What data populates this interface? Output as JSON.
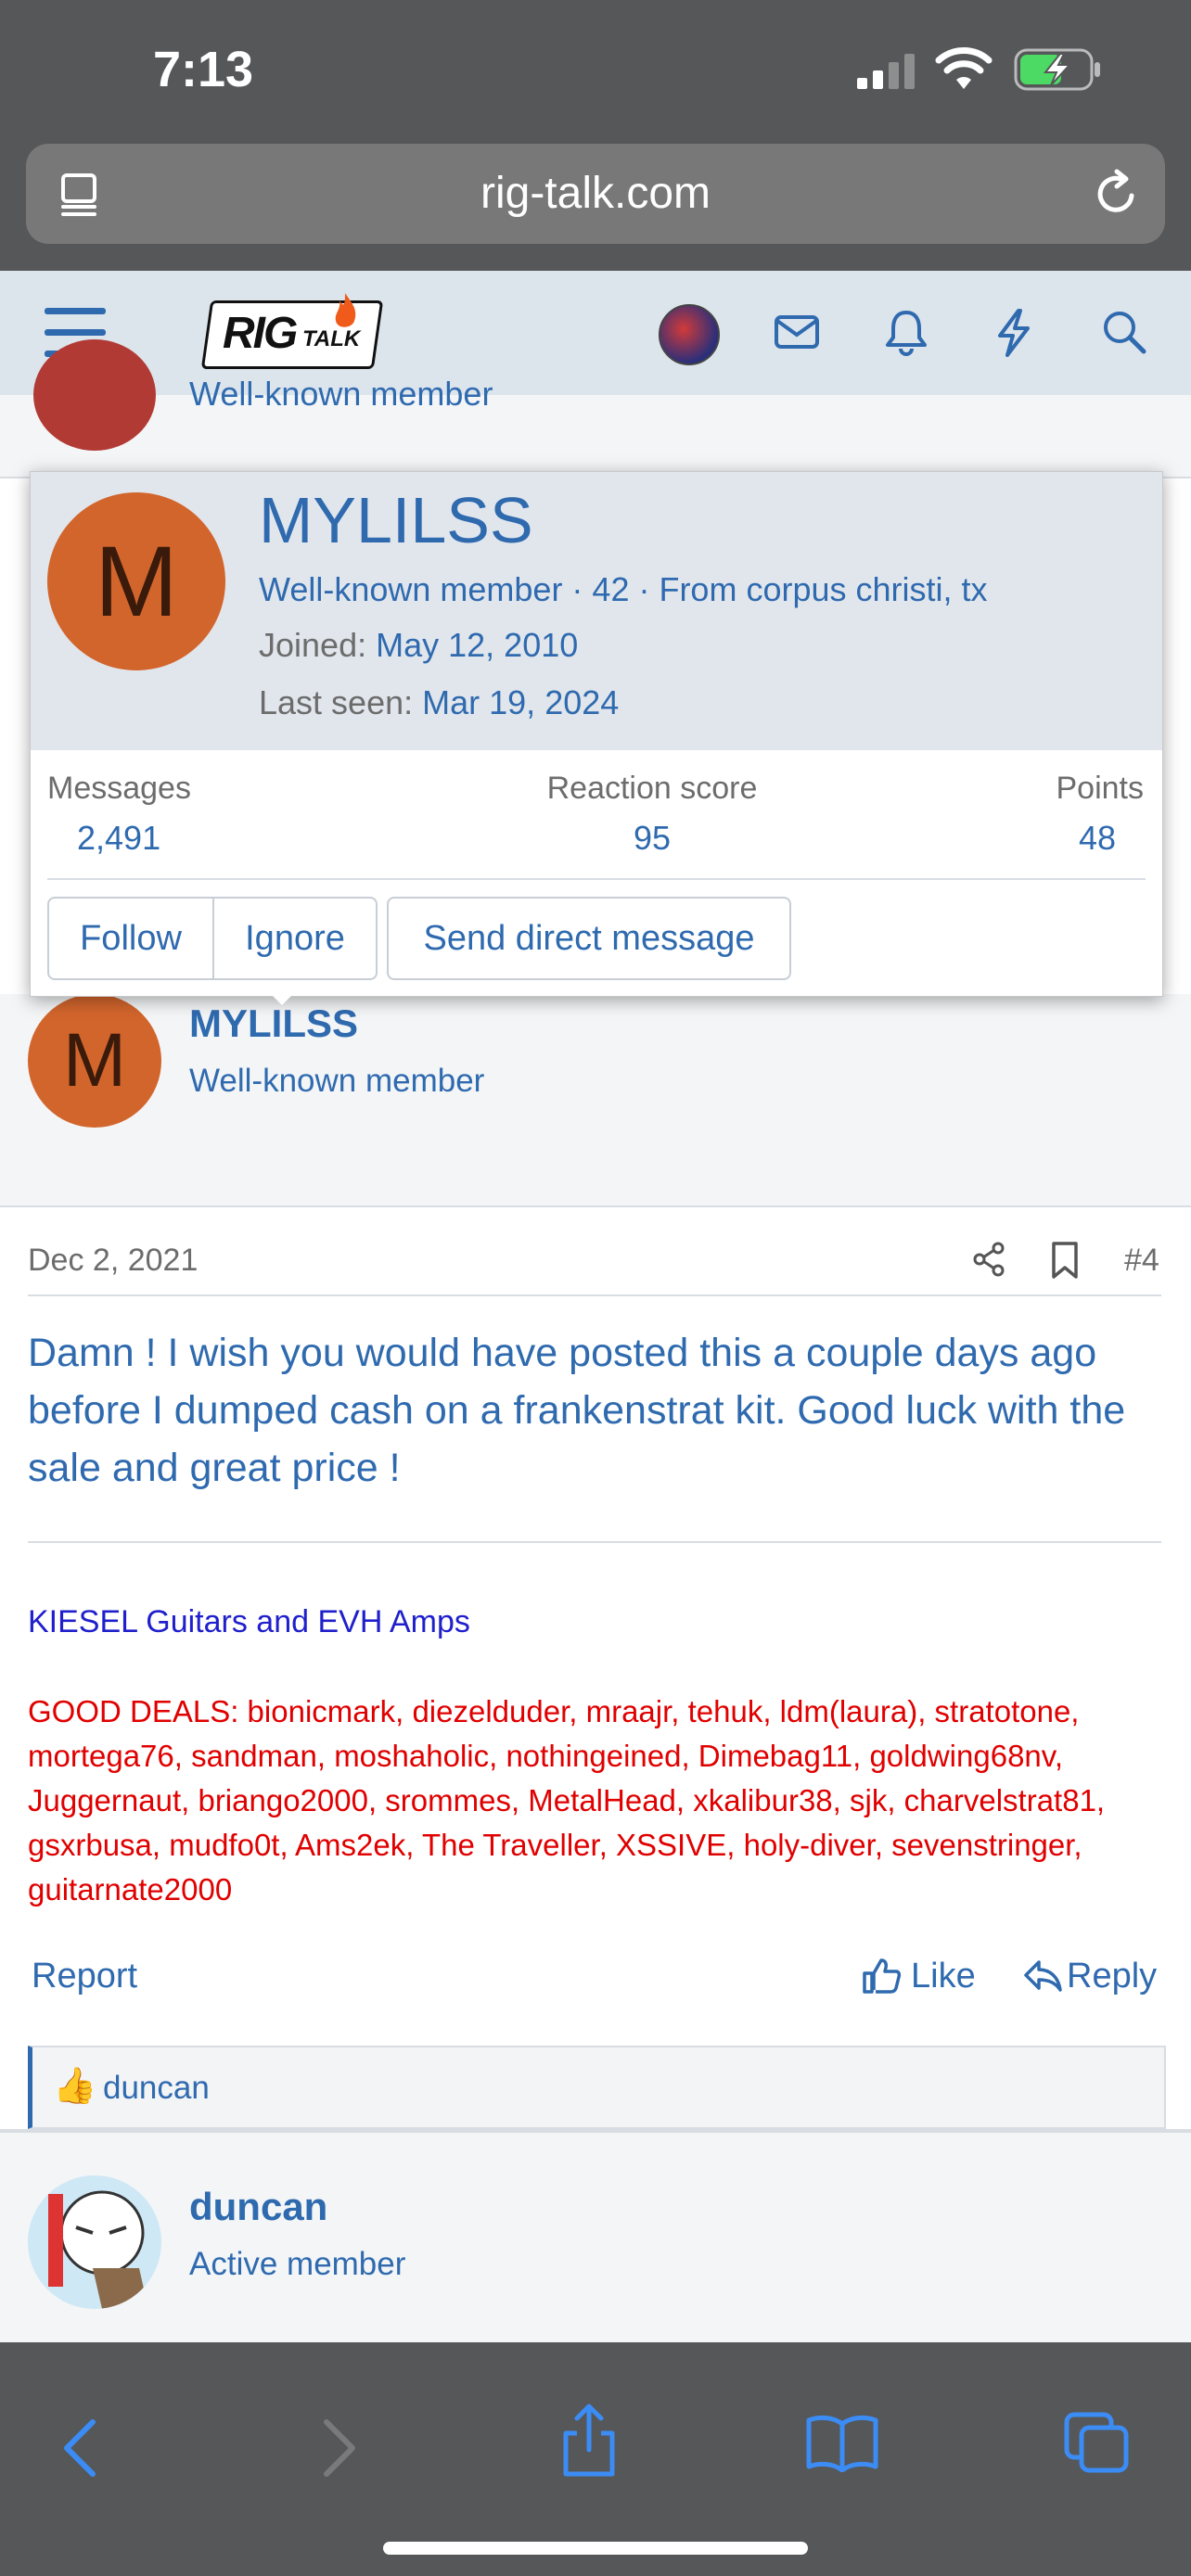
{
  "status": {
    "time": "7:13"
  },
  "browser": {
    "url": "rig-talk.com"
  },
  "site": {
    "logo_text": "RIG",
    "logo_sub": "TALK"
  },
  "header_partial": {
    "role": "Well-known member"
  },
  "popup": {
    "avatar_letter": "M",
    "username": "MYLILSS",
    "meta": "Well-known member · 42 · From corpus christi, tx",
    "joined_label": "Joined:",
    "joined_value": "May 12, 2010",
    "last_seen_label": "Last seen:",
    "last_seen_value": "Mar 19, 2024",
    "stats": [
      {
        "label": "Messages",
        "value": "2,491"
      },
      {
        "label": "Reaction score",
        "value": "95"
      },
      {
        "label": "Points",
        "value": "48"
      }
    ],
    "buttons": {
      "follow": "Follow",
      "ignore": "Ignore",
      "dm": "Send direct message"
    }
  },
  "post": {
    "avatar_letter": "M",
    "username": "MYLILSS",
    "role": "Well-known member",
    "date": "Dec 2, 2021",
    "number": "#4",
    "body": "Damn ! I wish you would have posted this a couple days ago before I dumped cash on a frankenstrat kit. Good luck with the sale and great price !",
    "signature_line1": "KIESEL Guitars and EVH Amps",
    "signature_line2": "GOOD DEALS: bionicmark, diezelduder, mraajr, tehuk, ldm(laura), stratotone, mortega76, sandman, moshaholic, nothingeined, Dimebag11, goldwing68nv, Juggernaut, briango2000, srommes, MetalHead, xkalibur38, sjk, charvelstrat81, gsxrbusa, mudfo0t, Ams2ek, The Traveller, XSSIVE, holy-diver, sevenstringer, guitarnate2000",
    "report": "Report",
    "like": "Like",
    "reply": "Reply",
    "liked_by": "duncan"
  },
  "next_post": {
    "username": "duncan",
    "role": "Active member"
  }
}
